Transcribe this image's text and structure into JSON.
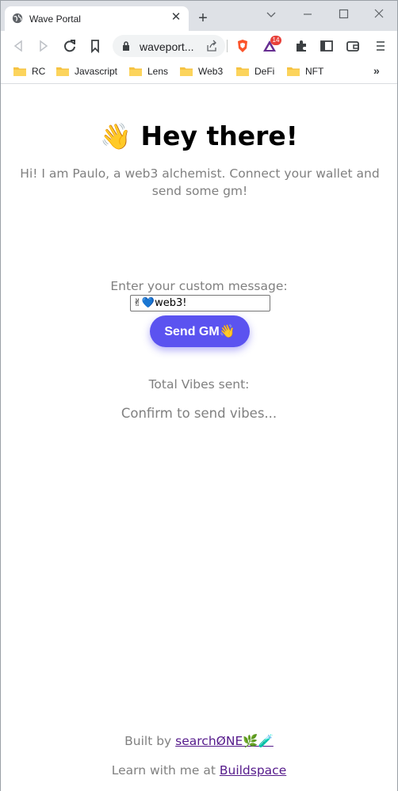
{
  "tab": {
    "title": "Wave Portal"
  },
  "omnibox": {
    "url": "waveport..."
  },
  "extensions": {
    "badge_count": "14"
  },
  "bookmarks": [
    {
      "label": "RC"
    },
    {
      "label": "Javascript"
    },
    {
      "label": "Lens"
    },
    {
      "label": "Web3"
    },
    {
      "label": "DeFi"
    },
    {
      "label": "NFT"
    }
  ],
  "page": {
    "heading_emoji": "👋",
    "heading_text": "Hey there!",
    "subtitle": "Hi! I am Paulo, a web3 alchemist. Connect your wallet and send some gm!",
    "prompt_label": "Enter your custom message:",
    "message_value": "✌💙web3!",
    "send_button": "Send GM👋",
    "total_label": "Total Vibes sent:",
    "confirm_text": "Confirm to send vibes...",
    "built_by_prefix": "Built by ",
    "built_by_link": "searchØNE🌿🧪",
    "learn_prefix": "Learn with me at ",
    "learn_link": "Buildspace"
  },
  "colors": {
    "accent_button": "#5b53f0",
    "muted_text": "#808080",
    "link": "#551a8b",
    "titlebar": "#dee1e6"
  },
  "icons": [
    "globe-icon",
    "close-icon",
    "plus-icon",
    "chevron-down-icon",
    "minimize-icon",
    "maximize-icon",
    "window-close-icon",
    "back-icon",
    "forward-icon",
    "reload-icon",
    "bookmark-icon",
    "lock-icon",
    "share-icon",
    "brave-shield-icon",
    "brave-rewards-icon",
    "puzzle-icon",
    "sidebar-icon",
    "wallet-icon",
    "menu-icon",
    "folder-icon",
    "chevron-double-right-icon"
  ]
}
